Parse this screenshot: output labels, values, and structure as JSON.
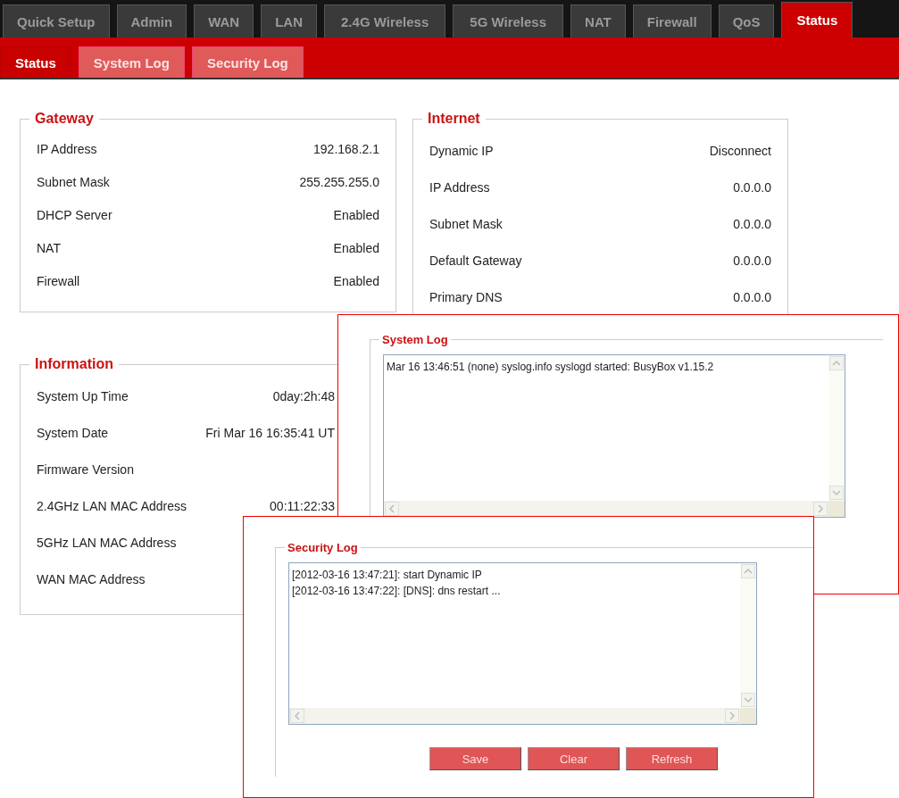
{
  "top_tabs": [
    {
      "label": "Quick Setup",
      "selected": false
    },
    {
      "label": "Admin",
      "selected": false
    },
    {
      "label": "WAN",
      "selected": false
    },
    {
      "label": "LAN",
      "selected": false
    },
    {
      "label": "2.4G Wireless",
      "selected": false
    },
    {
      "label": "5G Wireless",
      "selected": false
    },
    {
      "label": "NAT",
      "selected": false
    },
    {
      "label": "Firewall",
      "selected": false
    },
    {
      "label": "QoS",
      "selected": false
    },
    {
      "label": "Status",
      "selected": true
    }
  ],
  "sub_tabs": [
    {
      "label": "Status",
      "selected": true
    },
    {
      "label": "System Log",
      "selected": false
    },
    {
      "label": "Security Log",
      "selected": false
    }
  ],
  "gateway": {
    "title": "Gateway",
    "rows": [
      {
        "label": "IP Address",
        "value": "192.168.2.1"
      },
      {
        "label": "Subnet Mask",
        "value": "255.255.255.0"
      },
      {
        "label": "DHCP Server",
        "value": "Enabled"
      },
      {
        "label": "NAT",
        "value": "Enabled"
      },
      {
        "label": "Firewall",
        "value": "Enabled"
      }
    ]
  },
  "internet": {
    "title": "Internet",
    "rows": [
      {
        "label": "Dynamic IP",
        "value": "Disconnect"
      },
      {
        "label": "IP Address",
        "value": "0.0.0.0"
      },
      {
        "label": "Subnet Mask",
        "value": "0.0.0.0"
      },
      {
        "label": "Default Gateway",
        "value": "0.0.0.0"
      },
      {
        "label": "Primary DNS",
        "value": "0.0.0.0"
      }
    ]
  },
  "information": {
    "title": "Information",
    "rows": [
      {
        "label": "System Up Time",
        "value": "0day:2h:48"
      },
      {
        "label": "System Date",
        "value": "Fri Mar 16 16:35:41 UT"
      },
      {
        "label": "Firmware Version"
      },
      {
        "label": "2.4GHz LAN MAC Address",
        "value": "00:11:22:33"
      },
      {
        "label": "5GHz LAN MAC Address"
      },
      {
        "label": "WAN MAC Address"
      }
    ]
  },
  "system_log": {
    "title": "System Log",
    "lines": [
      "Mar 16 13:46:51 (none) syslog.info syslogd started: BusyBox v1.15.2"
    ]
  },
  "security_log": {
    "title": "Security Log",
    "lines": [
      "[2012-03-16 13:47:21]: start Dynamic IP",
      "[2012-03-16 13:47:22]: [DNS]: dns restart ..."
    ],
    "buttons": [
      "Save",
      "Clear",
      "Refresh"
    ]
  }
}
